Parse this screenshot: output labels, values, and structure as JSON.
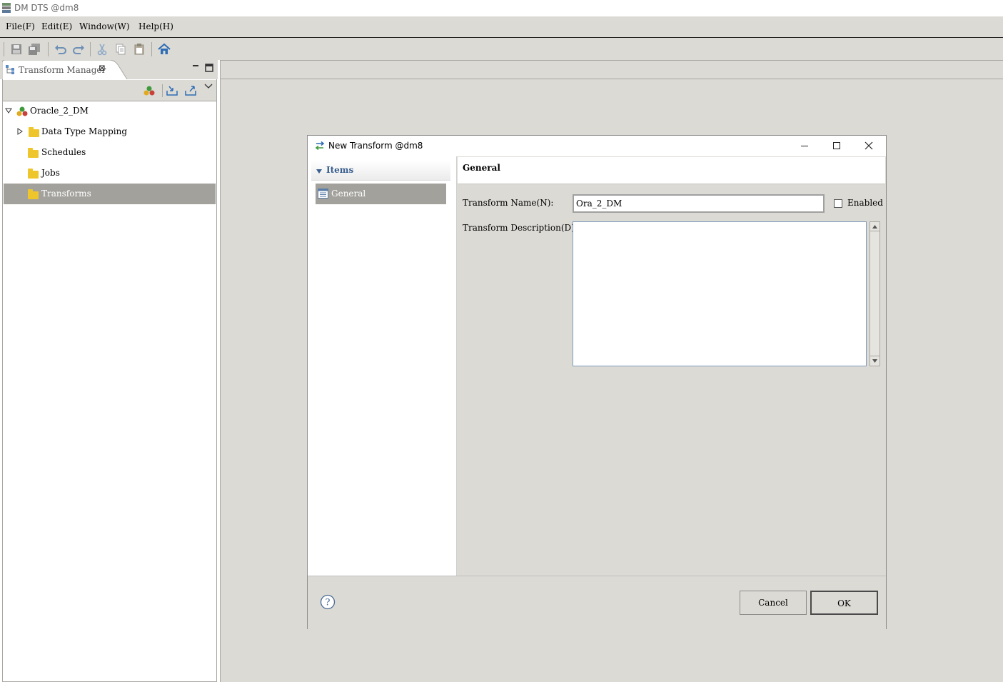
{
  "window": {
    "title": "DM DTS @dm8"
  },
  "menu": [
    {
      "label": "File(F)"
    },
    {
      "label": "Edit(E)"
    },
    {
      "label": "Window(W)"
    },
    {
      "label": "Help(H)"
    }
  ],
  "toolbar": {
    "buttons": [
      "save-icon",
      "save-all-icon",
      "undo-icon",
      "redo-icon",
      "cut-icon",
      "copy-icon",
      "paste-icon",
      "home-icon"
    ]
  },
  "view": {
    "tab_label": "Transform Manager",
    "tree": {
      "root": "Oracle_2_DM",
      "children": [
        {
          "label": "Data Type Mapping",
          "expandable": true
        },
        {
          "label": "Schedules"
        },
        {
          "label": "Jobs"
        },
        {
          "label": "Transforms",
          "selected": true
        }
      ]
    }
  },
  "dialog": {
    "title": "New Transform @dm8",
    "nav": {
      "section": "Items",
      "items": [
        {
          "label": "General",
          "selected": true
        }
      ]
    },
    "page_title": "General",
    "name_label": "Transform Name(N):",
    "name_value": "Ora_2_DM",
    "enabled_label": "Enabled",
    "enabled_checked": false,
    "desc_label": "Transform Description(D):",
    "desc_value": "",
    "cancel_label": "Cancel",
    "ok_label": "OK"
  },
  "colors": {
    "chrome": "#dcdad5",
    "selection": "#a3a19c",
    "accent": "#2d6db5",
    "folder": "#eec62b"
  }
}
